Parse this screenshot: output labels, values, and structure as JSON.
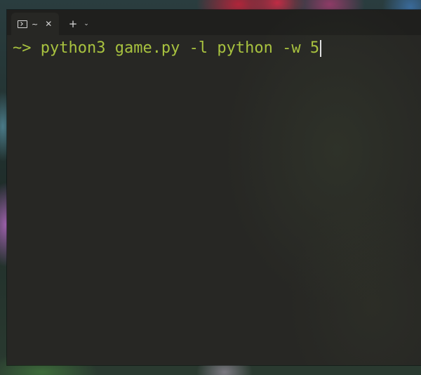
{
  "tab": {
    "title": "~",
    "icon": "terminal-icon",
    "close_glyph": "✕"
  },
  "toolbar": {
    "new_tab_glyph": "+",
    "dropdown_glyph": "⌄"
  },
  "terminal": {
    "prompt": "~>",
    "command": "python3 game.py -l python -w 5",
    "text_color": "#a8c23f",
    "background": "#272724"
  }
}
